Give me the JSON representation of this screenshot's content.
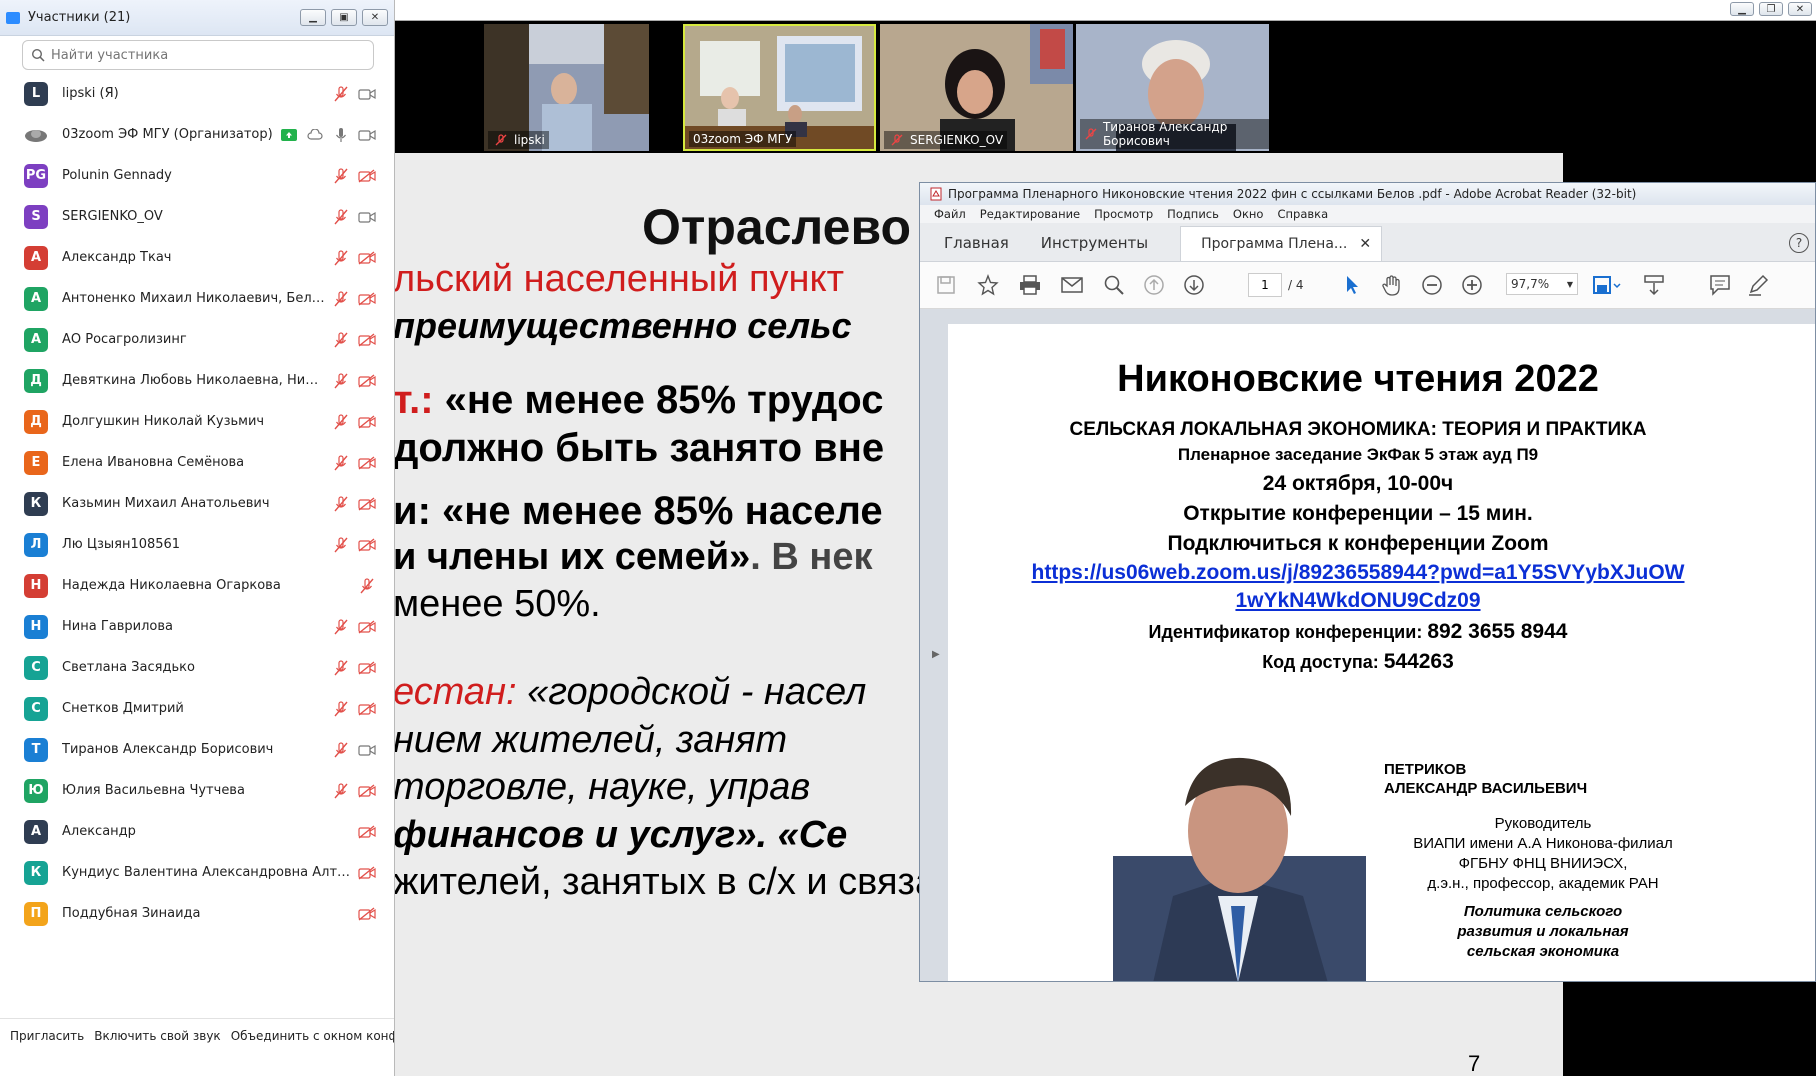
{
  "participants_panel": {
    "title": "Участники (21)",
    "search_placeholder": "Найти участника",
    "participants": [
      {
        "initials": "L",
        "name": "lipski (Я)",
        "color": "#2f3d52",
        "mic": "off",
        "video": "on"
      },
      {
        "initials": "",
        "name": "03zoom ЭФ МГУ (Организатор)",
        "color": "#ffffff",
        "mic": "on",
        "video": "on",
        "sharing": true
      },
      {
        "initials": "PG",
        "name": "Polunin Gennady",
        "color": "#7d3fc1",
        "mic": "off",
        "video": "off"
      },
      {
        "initials": "S",
        "name": "SERGIENKO_OV",
        "color": "#7d3fc1",
        "mic": "off",
        "video": "on"
      },
      {
        "initials": "А",
        "name": "Александр Ткач",
        "color": "#d43e34",
        "mic": "off",
        "video": "off"
      },
      {
        "initials": "А",
        "name": "Антоненко Михаил Николаевич, Беларусь ...",
        "color": "#1fa463",
        "mic": "off",
        "video": "off"
      },
      {
        "initials": "А",
        "name": "АО Росагролизинг",
        "color": "#1fa463",
        "mic": "off",
        "video": "off"
      },
      {
        "initials": "Д",
        "name": "Девяткина Любовь Николаевна, Нижегор...",
        "color": "#1fa463",
        "mic": "off",
        "video": "off"
      },
      {
        "initials": "Д",
        "name": "Долгушкин Николай Кузьмич",
        "color": "#e9661b",
        "mic": "off",
        "video": "off"
      },
      {
        "initials": "Е",
        "name": "Елена Ивановна Семёнова",
        "color": "#e9661b",
        "mic": "off",
        "video": "off"
      },
      {
        "initials": "К",
        "name": "Казьмин Михаил Анатольевич",
        "color": "#2f3d52",
        "mic": "off",
        "video": "off"
      },
      {
        "initials": "Л",
        "name": "Лю Цзыян108561",
        "color": "#1a7fd4",
        "mic": "off",
        "video": "off"
      },
      {
        "initials": "Н",
        "name": "Надежда Николаевна Огаркова",
        "color": "#d43e34",
        "mic": "off",
        "video": "none"
      },
      {
        "initials": "Н",
        "name": "Нина Гаврилова",
        "color": "#1a7fd4",
        "mic": "off",
        "video": "off"
      },
      {
        "initials": "С",
        "name": "Светлана Засядько",
        "color": "#16a394",
        "mic": "off",
        "video": "off"
      },
      {
        "initials": "С",
        "name": "Снетков Дмитрий",
        "color": "#16a394",
        "mic": "off",
        "video": "off"
      },
      {
        "initials": "Т",
        "name": "Тиранов Александр Борисович",
        "color": "#1a7fd4",
        "mic": "off",
        "video": "on"
      },
      {
        "initials": "Ю",
        "name": "Юлия Васильевна Чутчева",
        "color": "#1fa463",
        "mic": "off",
        "video": "off"
      },
      {
        "initials": "А",
        "name": "Александр",
        "color": "#2f3d52",
        "mic": "none",
        "video": "off"
      },
      {
        "initials": "К",
        "name": "Кундиус Валентина Александровна Алтайский ...",
        "color": "#16a394",
        "mic": "none",
        "video": "off"
      },
      {
        "initials": "П",
        "name": "Поддубная Зинаида",
        "color": "#f3a41b",
        "mic": "none",
        "video": "off"
      }
    ],
    "footer": {
      "invite": "Пригласить",
      "unmute_self": "Включить свой звук",
      "merge": "Объединить с окном конфере"
    }
  },
  "video_strip": {
    "tiles": [
      {
        "name": "lipski"
      },
      {
        "name": "03zoom ЭФ МГУ"
      },
      {
        "name": "SERGIENKO_OV"
      },
      {
        "name": "Тиранов Александр Борисович"
      }
    ]
  },
  "slide": {
    "title": "Отраслево",
    "lines": [
      {
        "parts": [
          {
            "t": "льский населенный пункт",
            "c": "#d01d1d"
          }
        ]
      },
      {
        "parts": [
          {
            "t": "преимущественно сельс",
            "c": "#000000"
          }
        ]
      },
      {
        "parts": [
          {
            "t": "т.:",
            "c": "#d01d1d"
          },
          {
            "t": " «не менее 85% трудос",
            "c": "#000000"
          }
        ]
      },
      {
        "parts": [
          {
            "t": "должно быть занято вне",
            "c": "#000000"
          }
        ]
      },
      {
        "parts": [
          {
            "t": "и:  «не менее 85% населе",
            "c": "#000000"
          }
        ]
      },
      {
        "parts": [
          {
            "t": "и члены их семей»",
            "c": "#000000"
          },
          {
            "t": ". В нек",
            "c": "#444444"
          }
        ]
      },
      {
        "parts": [
          {
            "t": "менее  50%.",
            "c": "#000000"
          }
        ]
      },
      {
        "parts": [
          {
            "t": "естан:",
            "c": "#d01d1d"
          },
          {
            "t": " «городской - насел",
            "c": "#000000"
          }
        ]
      },
      {
        "parts": [
          {
            "t": "нием    жителей,    занят",
            "c": "#000000"
          }
        ]
      },
      {
        "parts": [
          {
            "t": "торговле,    науке,    управ",
            "c": "#000000"
          }
        ]
      },
      {
        "parts": [
          {
            "t": "финансов  и  услуг».  «Се",
            "c": "#000000"
          }
        ]
      },
      {
        "parts": [
          {
            "t": "жителей, занятых в с/х и связанных с ним отраслях…»",
            "c": "#000000"
          }
        ]
      }
    ],
    "page_number": "7"
  },
  "acrobat": {
    "title": "Программа Пленарного Никоновские чтения 2022 фин с ссылками Белов .pdf - Adobe Acrobat Reader (32-bit)",
    "menu": [
      "Файл",
      "Редактирование",
      "Просмотр",
      "Подпись",
      "Окно",
      "Справка"
    ],
    "tabs": {
      "home": "Главная",
      "tools": "Инструменты",
      "doc": "Программа Плена..."
    },
    "toolbar": {
      "page_current": "1",
      "page_total": "/ 4",
      "zoom": "97,7%"
    },
    "document": {
      "heading": "Никоновские чтения 2022",
      "subheading": "СЕЛЬСКАЯ ЛОКАЛЬНАЯ ЭКОНОМИКА: ТЕОРИЯ И ПРАКТИКА",
      "session": "Пленарное заседание ЭкФак 5 этаж ауд П9",
      "date": "24 октября, 10-00ч",
      "opening": "Открытие конференции – 15 мин.",
      "connect": "Подключиться к конференции Zoom",
      "link_line1": "https://us06web.zoom.us/j/89236558944?pwd=a1Y5SVYybXJuOW",
      "link_line2": "1wYkN4WkdONU9Cdz09",
      "conf_id_label": "Идентификатор конференции: ",
      "conf_id_value": "892 3655 8944",
      "access_label": "Код доступа: ",
      "access_value": "544263",
      "speaker_surname": "ПЕТРИКОВ",
      "speaker_name": "АЛЕКСАНДР ВАСИЛЬЕВИЧ",
      "role": "Руководитель",
      "org1": "ВИАПИ имени А.А Никонова-филиал",
      "org2": "ФГБНУ ФНЦ ВНИИЭСХ,",
      "degree": "д.э.н., профессор, академик РАН",
      "topic1": "Политика сельского",
      "topic2": "развития и локальная",
      "topic3": "сельская экономика"
    }
  }
}
